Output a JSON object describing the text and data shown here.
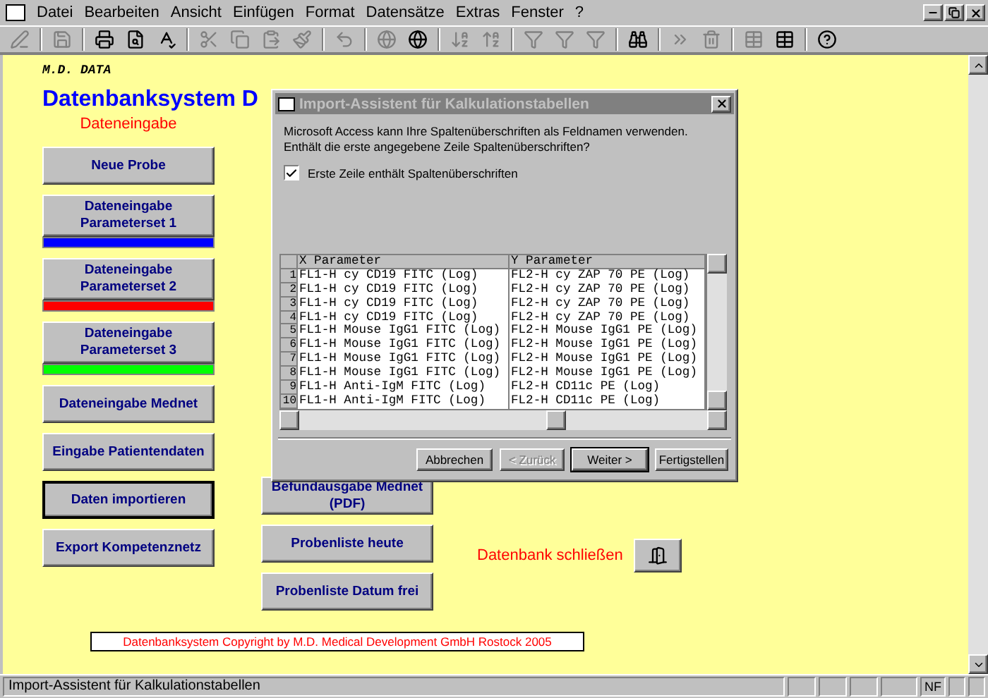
{
  "menu": [
    {
      "label": "Datei"
    },
    {
      "label": "Bearbeiten"
    },
    {
      "label": "Ansicht"
    },
    {
      "label": "Einfügen"
    },
    {
      "label": "Format"
    },
    {
      "label": "Datensätze"
    },
    {
      "label": "Extras"
    },
    {
      "label": "Fenster"
    },
    {
      "label": "?"
    }
  ],
  "form": {
    "brand": "M.D. DATA",
    "title": "Datenbanksystem D",
    "section_label": "Dateneingabe",
    "left_buttons": [
      {
        "label": "Neue Probe",
        "selected": false
      },
      {
        "label": "Dateneingabe Parameterset 1",
        "selected": false,
        "color": "#0000ff"
      },
      {
        "label": "Dateneingabe Parameterset 2",
        "selected": false,
        "color": "#ff0000"
      },
      {
        "label": "Dateneingabe Parameterset 3",
        "selected": false,
        "color": "#00ff00"
      },
      {
        "label": "Dateneingabe Mednet",
        "selected": false
      },
      {
        "label": "Eingabe Patientendaten",
        "selected": false
      },
      {
        "label": "Daten importieren",
        "selected": true
      },
      {
        "label": "Export Kompetenznetz",
        "selected": false
      }
    ],
    "right_buttons": [
      {
        "label": "Befundausgabe Mednet (PDF)"
      },
      {
        "label": "Probenliste heute"
      },
      {
        "label": "Probenliste Datum frei"
      }
    ],
    "close_label": "Datenbank schließen",
    "copyright": "Datenbanksystem Copyright by M.D. Medical Development GmbH Rostock 2005"
  },
  "dialog": {
    "title": "Import-Assistent für Kalkulationstabellen",
    "message": "Microsoft Access kann Ihre Spaltenüberschriften als Feldnamen verwenden. Enthält die erste angegebene Zeile Spaltenüberschriften?",
    "checkbox": {
      "label": "Erste Zeile enthält Spaltenüberschriften",
      "checked": true
    },
    "columns": [
      "X Parameter",
      "Y Parameter"
    ],
    "rows": [
      {
        "number": "1",
        "cells": [
          "FL1-H cy CD19 FITC (Log)",
          "FL2-H cy ZAP 70 PE (Log)"
        ]
      },
      {
        "number": "2",
        "cells": [
          "FL1-H cy CD19 FITC (Log)",
          "FL2-H cy ZAP 70 PE (Log)"
        ]
      },
      {
        "number": "3",
        "cells": [
          "FL1-H cy CD19 FITC (Log)",
          "FL2-H cy ZAP 70 PE (Log)"
        ]
      },
      {
        "number": "4",
        "cells": [
          "FL1-H cy CD19 FITC (Log)",
          "FL2-H cy ZAP 70 PE (Log)"
        ]
      },
      {
        "number": "5",
        "cells": [
          "FL1-H Mouse IgG1 FITC (Log)",
          "FL2-H Mouse IgG1 PE (Log)"
        ]
      },
      {
        "number": "6",
        "cells": [
          "FL1-H Mouse IgG1 FITC (Log)",
          "FL2-H Mouse IgG1 PE (Log)"
        ]
      },
      {
        "number": "7",
        "cells": [
          "FL1-H Mouse IgG1 FITC (Log)",
          "FL2-H Mouse IgG1 PE (Log)"
        ]
      },
      {
        "number": "8",
        "cells": [
          "FL1-H Mouse IgG1 FITC (Log)",
          "FL2-H Mouse IgG1 PE (Log)"
        ]
      },
      {
        "number": "9",
        "cells": [
          "FL1-H Anti-IgM FITC (Log)",
          "FL2-H CD11c PE (Log)"
        ]
      },
      {
        "number": "10",
        "cells": [
          "FL1-H Anti-IgM FITC (Log)",
          "FL2-H CD11c PE (Log)"
        ]
      }
    ],
    "buttons": [
      {
        "label": "Abbrechen",
        "disabled": false,
        "default": false
      },
      {
        "label": "< Zurück",
        "disabled": true,
        "default": false
      },
      {
        "label": "Weiter >",
        "disabled": false,
        "default": true
      },
      {
        "label": "Fertigstellen",
        "disabled": false,
        "default": false
      }
    ]
  },
  "status_bar": {
    "text": "Import-Assistent für Kalkulationstabellen",
    "indicators": [
      "NF"
    ]
  }
}
